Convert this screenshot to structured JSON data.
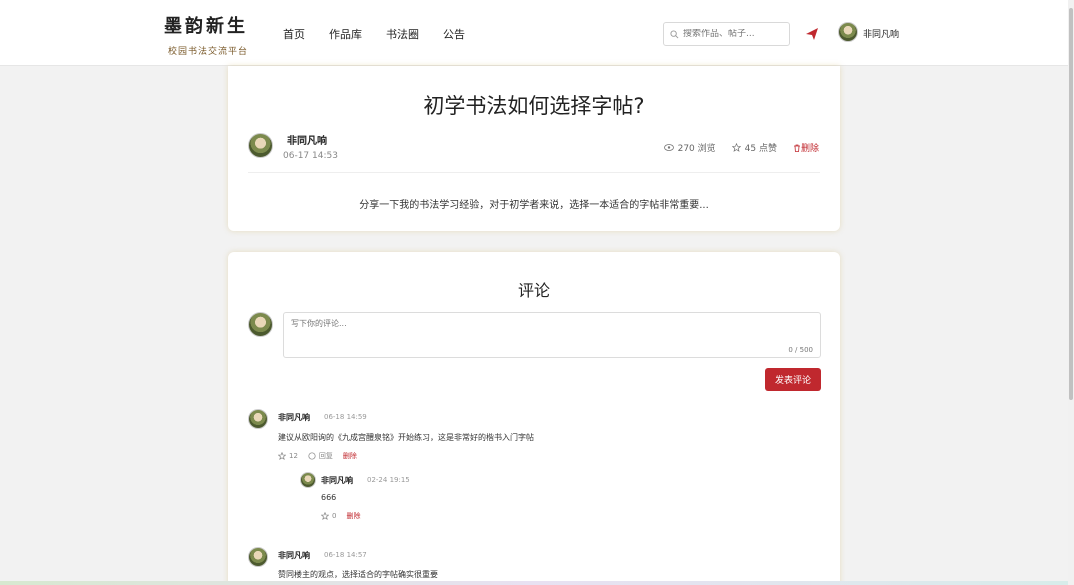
{
  "header": {
    "logo_title": "墨韵新生",
    "logo_subtitle": "校园书法交流平台",
    "nav": [
      "首页",
      "作品库",
      "书法圈",
      "公告"
    ],
    "search_placeholder": "搜索作品、帖子...",
    "user_name": "非同凡响"
  },
  "post": {
    "title": "初学书法如何选择字帖?",
    "author": "非同凡响",
    "date": "06-17 14:53",
    "views": "270 浏览",
    "likes": "45 点赞",
    "delete_label": "删除",
    "content": "分享一下我的书法学习经验，对于初学者来说，选择一本适合的字帖非常重要..."
  },
  "comments_section": {
    "heading": "评论",
    "input_placeholder": "写下你的评论...",
    "char_count": "0 / 500",
    "publish_label": "发表评论",
    "comments": [
      {
        "user": "非同凡响",
        "time": "06-18 14:59",
        "text": "建议从欧阳询的《九成宫醴泉铭》开始练习，这是非常好的楷书入门字帖",
        "likes": "12",
        "reply_label": "回复",
        "delete_label": "删除",
        "replies": [
          {
            "user": "非同凡响",
            "time": "02-24 19:15",
            "text": "666",
            "likes": "0",
            "delete_label": "删除"
          }
        ]
      },
      {
        "user": "非同凡响",
        "time": "06-18 14:57",
        "text": "赞同楼主的观点，选择适合的字帖确实很重要"
      }
    ]
  },
  "colors": {
    "accent": "#c0282e",
    "background": "#f2f2f2"
  }
}
